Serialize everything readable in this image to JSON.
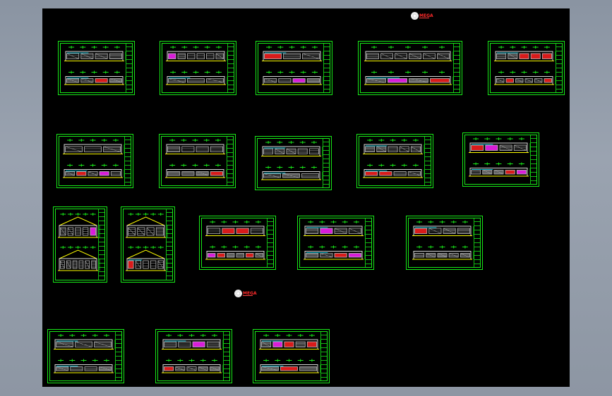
{
  "app": {
    "colors": {
      "background": "#9aa3b0",
      "canvas": "#000000",
      "frame": "#18e818",
      "accent_red": "#ff2020",
      "accent_magenta": "#ff22ff",
      "accent_yellow": "#ffff00",
      "accent_cyan": "#00e5ff"
    }
  },
  "logos": [
    {
      "text": "MEGA",
      "icon": "gear-logo-icon"
    },
    {
      "text": "MEGA",
      "icon": "gear-logo-icon"
    }
  ],
  "sheets": [
    {
      "variant": "a"
    },
    {
      "variant": "b"
    },
    {
      "variant": "c"
    },
    {
      "variant": "d"
    },
    {
      "variant": "e"
    },
    {
      "variant": "f"
    },
    {
      "variant": "g"
    },
    {
      "variant": "h"
    },
    {
      "variant": "i"
    },
    {
      "variant": "j"
    },
    {
      "variant": "k"
    },
    {
      "variant": "l"
    },
    {
      "variant": "m"
    },
    {
      "variant": "n"
    },
    {
      "variant": "o"
    },
    {
      "variant": "p"
    },
    {
      "variant": "q"
    },
    {
      "variant": "r"
    }
  ]
}
